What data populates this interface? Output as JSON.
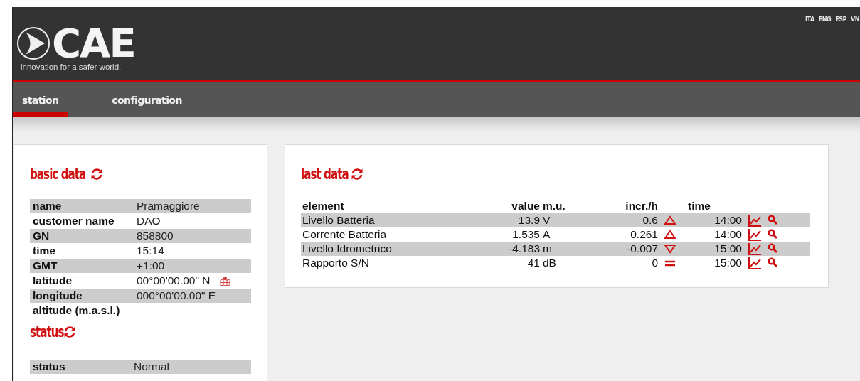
{
  "header": {
    "logo": "CAE",
    "tagline": "innovation for a safer world.",
    "languages": [
      "ITA",
      "ENG",
      "ESP",
      "VN"
    ]
  },
  "tabs": [
    {
      "label": "station",
      "selected": true
    },
    {
      "label": "configuration",
      "selected": false
    }
  ],
  "basic_data": {
    "title": "basic data",
    "rows": [
      {
        "label": "name",
        "value": "Pramaggiore"
      },
      {
        "label": "customer name",
        "value": "DAO"
      },
      {
        "label": "GN",
        "value": "858800"
      },
      {
        "label": "time",
        "value": "15:14"
      },
      {
        "label": "GMT",
        "value": "+1:00"
      },
      {
        "label": "latitude",
        "value": "00°00'00.00\" N",
        "map_link": true
      },
      {
        "label": "longitude",
        "value": "000°00'00.00\" E"
      },
      {
        "label": "altitude (m.a.s.l.)"
      }
    ]
  },
  "status": {
    "title": "status",
    "rows": [
      {
        "label": "status",
        "value": "Normal"
      }
    ]
  },
  "last_data": {
    "title": "last data",
    "columns": [
      "element",
      "value",
      "m.u.",
      "incr./h",
      "time"
    ],
    "rows": [
      {
        "element": "Livello Batteria",
        "value": "13.9",
        "unit": "V",
        "incr": "0.6",
        "kind": "up",
        "time": "14:00"
      },
      {
        "element": "Corrente Batteria",
        "value": "1.535",
        "unit": "A",
        "incr": "0.261",
        "kind": "up",
        "time": "14:00"
      },
      {
        "element": "Livello Idrometrico",
        "value": "-4.183",
        "unit": "m",
        "incr": "-0.007",
        "kind": "down",
        "time": "15:00"
      },
      {
        "element": "Rapporto S/N",
        "value": "41",
        "unit": "dB",
        "incr": "0",
        "kind": "flat",
        "time": "15:00"
      }
    ]
  }
}
